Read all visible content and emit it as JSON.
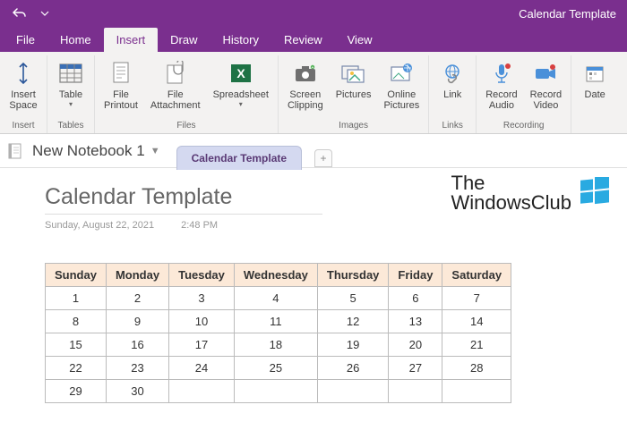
{
  "window": {
    "title": "Calendar Template"
  },
  "menu": {
    "file": "File",
    "home": "Home",
    "insert": "Insert",
    "draw": "Draw",
    "history": "History",
    "review": "Review",
    "view": "View"
  },
  "ribbon": {
    "insert_space": "Insert\nSpace",
    "table": "Table",
    "file_printout": "File\nPrintout",
    "file_attachment": "File\nAttachment",
    "spreadsheet": "Spreadsheet",
    "screen_clipping": "Screen\nClipping",
    "pictures": "Pictures",
    "online_pictures": "Online\nPictures",
    "link": "Link",
    "record_audio": "Record\nAudio",
    "record_video": "Record\nVideo",
    "date": "Date",
    "groups": {
      "insert": "Insert",
      "tables": "Tables",
      "files": "Files",
      "images": "Images",
      "links": "Links",
      "recording": "Recording"
    }
  },
  "notebook": {
    "name": "New Notebook 1",
    "section": "Calendar Template"
  },
  "page": {
    "title": "Calendar Template",
    "date": "Sunday, August 22, 2021",
    "time": "2:48 PM"
  },
  "watermark": {
    "line1": "The",
    "line2": "WindowsClub"
  },
  "calendar": {
    "headers": [
      "Sunday",
      "Monday",
      "Tuesday",
      "Wednesday",
      "Thursday",
      "Friday",
      "Saturday"
    ],
    "rows": [
      [
        "1",
        "2",
        "3",
        "4",
        "5",
        "6",
        "7"
      ],
      [
        "8",
        "9",
        "10",
        "11",
        "12",
        "13",
        "14"
      ],
      [
        "15",
        "16",
        "17",
        "18",
        "19",
        "20",
        "21"
      ],
      [
        "22",
        "23",
        "24",
        "25",
        "26",
        "27",
        "28"
      ],
      [
        "29",
        "30",
        "",
        "",
        "",
        "",
        ""
      ]
    ]
  }
}
